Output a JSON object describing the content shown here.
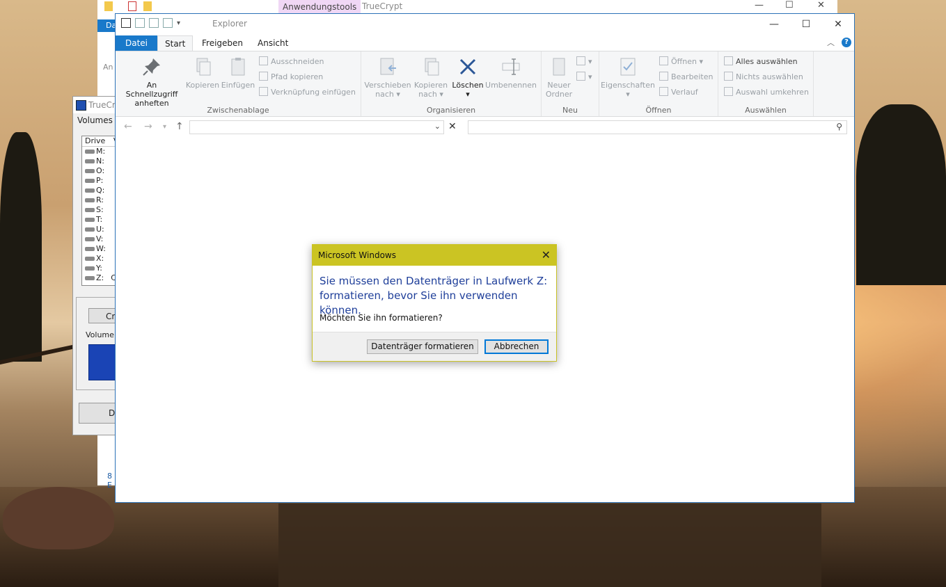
{
  "background_window": {
    "contextual_tab": "Anwendungstools",
    "title": "TrueCrypt",
    "file_tab_fragment": "Da",
    "pin_fragment": "An",
    "status_fragment": "8 E"
  },
  "truecrypt": {
    "title_fragment": "TrueCry",
    "menu": "Volumes",
    "column_drive": "Drive",
    "column_v": "V",
    "drives": [
      "M:",
      "N:",
      "O:",
      "P:",
      "Q:",
      "R:",
      "S:",
      "T:",
      "U:",
      "V:",
      "W:",
      "X:",
      "Y:",
      "Z:"
    ],
    "last_drive_extra": "C",
    "create_button_fragment": "Cr",
    "volume_group": "Volume",
    "dismount_button_fragment": "Di"
  },
  "explorer": {
    "title": "Explorer",
    "tabs": {
      "datei": "Datei",
      "start": "Start",
      "freigeben": "Freigeben",
      "ansicht": "Ansicht"
    },
    "help_glyph": "?",
    "ribbon": {
      "clipboard": {
        "group": "Zwischenablage",
        "pin_line1": "An Schnellzugriff",
        "pin_line2": "anheften",
        "copy": "Kopieren",
        "paste": "Einfügen",
        "cut": "Ausschneiden",
        "copy_path": "Pfad kopieren",
        "paste_shortcut": "Verknüpfung einfügen"
      },
      "organize": {
        "group": "Organisieren",
        "move_line1": "Verschieben",
        "move_line2": "nach",
        "copyto_line1": "Kopieren",
        "copyto_line2": "nach",
        "delete": "Löschen",
        "rename": "Umbenennen"
      },
      "new": {
        "group": "Neu",
        "folder_line1": "Neuer",
        "folder_line2": "Ordner"
      },
      "open": {
        "group": "Öffnen",
        "properties": "Eigenschaften",
        "open": "Öffnen",
        "edit": "Bearbeiten",
        "history": "Verlauf"
      },
      "select": {
        "group": "Auswählen",
        "select_all": "Alles auswählen",
        "select_none": "Nichts auswählen",
        "invert": "Auswahl umkehren"
      }
    },
    "address": {
      "value": ""
    },
    "search": {
      "value": ""
    }
  },
  "dialog": {
    "title": "Microsoft Windows",
    "main_line1": "Sie müssen den Datenträger in Laufwerk Z:",
    "main_line2": "formatieren, bevor Sie ihn verwenden können.",
    "question": "Möchten Sie ihn formatieren?",
    "format_button": "Datenträger formatieren",
    "cancel_button": "Abbrechen"
  },
  "colors": {
    "accent": "#1979ca",
    "dialog_title_bar": "#cbc423",
    "dialog_heading": "#1f3f9a"
  }
}
